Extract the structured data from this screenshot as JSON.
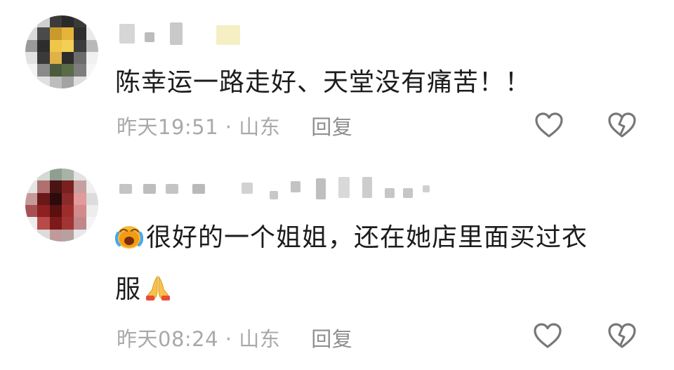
{
  "comments": [
    {
      "text": "陈幸运一路走好、天堂没有痛苦！！",
      "time": "昨天19:51",
      "location": "山东",
      "reply_label": "回复"
    },
    {
      "text_line1": "很好的一个姐姐，还在她店里面买过衣",
      "text_line2": "服",
      "emoji_start": "crying-face-emoji",
      "emoji_end": "folded-hands-emoji",
      "time": "昨天08:24",
      "location": "山东",
      "reply_label": "回复"
    }
  ],
  "meta_separator": " · ",
  "icons": {
    "like": "heart-outline-icon",
    "dislike": "broken-heart-icon"
  }
}
